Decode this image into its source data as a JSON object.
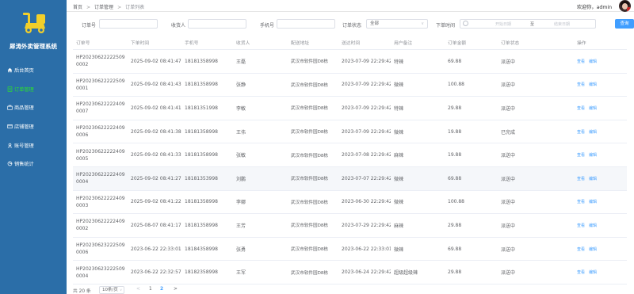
{
  "app": {
    "title": "犀涛外卖管理系统"
  },
  "nav": [
    {
      "label": "后台首页",
      "icon": "home-icon",
      "active": false
    },
    {
      "label": "订单管理",
      "icon": "order-icon",
      "active": true
    },
    {
      "label": "商品管理",
      "icon": "goods-icon",
      "active": false
    },
    {
      "label": "店铺管理",
      "icon": "shop-icon",
      "active": false
    },
    {
      "label": "账号管理",
      "icon": "account-icon",
      "active": false
    },
    {
      "label": "销售统计",
      "icon": "stats-icon",
      "active": false
    }
  ],
  "breadcrumb": [
    "首页",
    "订单管理",
    "订单列表"
  ],
  "user": {
    "welcome": "欢迎你，admin"
  },
  "filter": {
    "order_no_label": "订单号",
    "receiver_label": "收货人",
    "phone_label": "手机号",
    "status_label": "订单状态",
    "status_value": "全部",
    "time_label": "下单时间",
    "start_placeholder": "开始日期",
    "range_sep": "至",
    "end_placeholder": "结束日期",
    "query_label": "查询"
  },
  "table": {
    "columns": [
      "订单号",
      "下单时间",
      "手机号",
      "收货人",
      "配送地址",
      "送达时间",
      "用户备注",
      "订单金额",
      "订单状态",
      "操作"
    ],
    "action_view": "查看",
    "action_edit": "编辑",
    "rows": [
      {
        "order_no": "HP20230622222509 0002",
        "order_time": "2025-09-02 08:41:47",
        "phone": "18181358998",
        "receiver": "王磊",
        "address": "武汉市软件园D8栋",
        "delivery_time": "2023-07-09 22:29:42",
        "remark": "特辣",
        "amount": "69.88",
        "status": "派送中"
      },
      {
        "order_no": "HP20230622222509 0001",
        "order_time": "2025-09-02 08:41:43",
        "phone": "18181358998",
        "receiver": "张静",
        "address": "武汉市软件园D8栋",
        "delivery_time": "2023-07-09 22:29:42",
        "remark": "微辣",
        "amount": "100.88",
        "status": "派送中"
      },
      {
        "order_no": "HP20230622222409 0007",
        "order_time": "2025-09-02 08:41:41",
        "phone": "18181351998",
        "receiver": "李敏",
        "address": "武汉市软件园D8栋",
        "delivery_time": "2023-07-09 22:29:42",
        "remark": "特辣",
        "amount": "29.88",
        "status": "派送中"
      },
      {
        "order_no": "HP20230622222409 0006",
        "order_time": "2025-09-02 08:41:38",
        "phone": "18181358998",
        "receiver": "王伟",
        "address": "武汉市软件园D8栋",
        "delivery_time": "2023-07-09 22:29:42",
        "remark": "微辣",
        "amount": "19.88",
        "status": "已完成"
      },
      {
        "order_no": "HP20230622222409 0005",
        "order_time": "2025-09-02 08:41:33",
        "phone": "18181358998",
        "receiver": "张敏",
        "address": "武汉市软件园D8栋",
        "delivery_time": "2023-07-08 22:29:42",
        "remark": "麻辣",
        "amount": "19.88",
        "status": "派送中"
      },
      {
        "order_no": "HP20230622222409 0004",
        "order_time": "2025-09-02 08:41:27",
        "phone": "18181353998",
        "receiver": "刘鹏",
        "address": "武汉市软件园D8栋",
        "delivery_time": "2023-07-07 22:29:42",
        "remark": "微辣",
        "amount": "69.88",
        "status": "派送中"
      },
      {
        "order_no": "HP20230622222409 0003",
        "order_time": "2025-09-02 08:41:22",
        "phone": "18181358998",
        "receiver": "李娜",
        "address": "武汉市软件园D8栋",
        "delivery_time": "2023-06-30 22:29:42",
        "remark": "微辣",
        "amount": "100.88",
        "status": "派送中"
      },
      {
        "order_no": "HP20230622222409 0002",
        "order_time": "2025-08-07 08:41:17",
        "phone": "18181358998",
        "receiver": "王芳",
        "address": "武汉市软件园D8栋",
        "delivery_time": "2023-07-29 22:29:42",
        "remark": "麻辣",
        "amount": "29.88",
        "status": "派送中"
      },
      {
        "order_no": "HP20230623222509 0006",
        "order_time": "2023-06-22 22:33:01",
        "phone": "18184358998",
        "receiver": "张勇",
        "address": "武汉市软件园D8栋",
        "delivery_time": "2023-06-22 22:33:01",
        "remark": "微辣",
        "amount": "69.88",
        "status": "派送中"
      },
      {
        "order_no": "HP20230623222509 0004",
        "order_time": "2023-06-22 22:32:57",
        "phone": "18182358998",
        "receiver": "王军",
        "address": "武汉市软件园D8栋",
        "delivery_time": "2023-06-24 22:29:42",
        "remark": "超级超级辣",
        "amount": "29.88",
        "status": "派送中"
      }
    ]
  },
  "pagination": {
    "total": "共 20 条",
    "page_size": "10条/页",
    "prev": "<",
    "page1": "1",
    "page2": "2",
    "next": ">",
    "current_page": 2
  },
  "colors": {
    "sidebar": "#2b6ea8",
    "active_nav": "#2ce02c",
    "primary": "#409eff",
    "logo": "#f2cf2a"
  }
}
